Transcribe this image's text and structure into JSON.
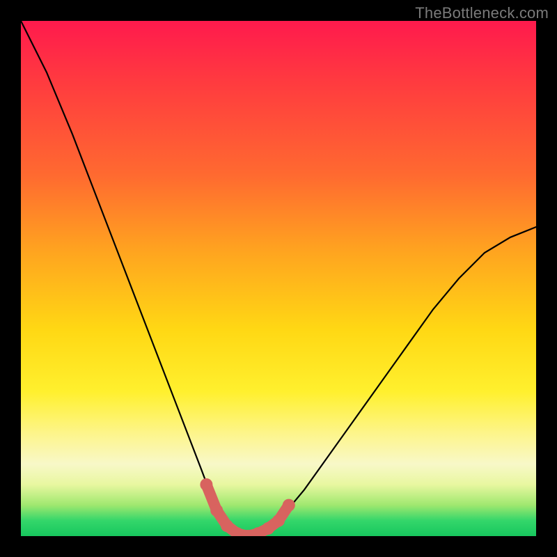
{
  "watermark": "TheBottleneck.com",
  "colors": {
    "frame": "#000000",
    "curve": "#000000",
    "valley_highlight": "#d8635f",
    "gradient_top": "#ff1a4d",
    "gradient_bottom": "#17c75e"
  },
  "chart_data": {
    "type": "line",
    "title": "",
    "xlabel": "",
    "ylabel": "",
    "xlim": [
      0,
      100
    ],
    "ylim": [
      0,
      100
    ],
    "grid": false,
    "legend": false,
    "note": "Bottleneck curve: high (≈100) at left, drops steeply to ≈0 near x≈40, flat minimum x≈40–48, rises toward ≈60 at right edge.",
    "x": [
      0,
      5,
      10,
      15,
      20,
      25,
      30,
      35,
      38,
      40,
      42,
      44,
      46,
      48,
      50,
      55,
      60,
      65,
      70,
      75,
      80,
      85,
      90,
      95,
      100
    ],
    "y": [
      100,
      90,
      78,
      65,
      52,
      39,
      26,
      13,
      5,
      1,
      0,
      0,
      0,
      1,
      3,
      9,
      16,
      23,
      30,
      37,
      44,
      50,
      55,
      58,
      60
    ],
    "series": [
      {
        "name": "bottleneck-curve",
        "x": [
          0,
          5,
          10,
          15,
          20,
          25,
          30,
          35,
          38,
          40,
          42,
          44,
          46,
          48,
          50,
          55,
          60,
          65,
          70,
          75,
          80,
          85,
          90,
          95,
          100
        ],
        "y": [
          100,
          90,
          78,
          65,
          52,
          39,
          26,
          13,
          5,
          1,
          0,
          0,
          0,
          1,
          3,
          9,
          16,
          23,
          30,
          37,
          44,
          50,
          55,
          58,
          60
        ]
      },
      {
        "name": "valley-highlight",
        "x": [
          36,
          38,
          40,
          42,
          44,
          46,
          48,
          50,
          52
        ],
        "y": [
          10,
          5,
          2,
          0.5,
          0,
          0.5,
          1.5,
          3,
          6
        ]
      }
    ]
  }
}
